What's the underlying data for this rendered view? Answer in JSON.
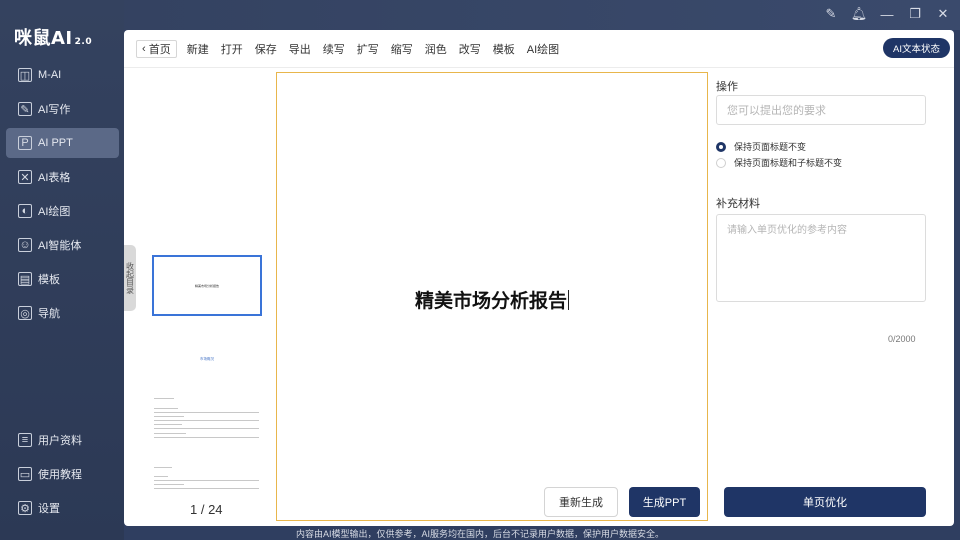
{
  "app": {
    "logo_text": "咪鼠AI",
    "logo_version": "2.0"
  },
  "sidebar": {
    "items": [
      {
        "label": "M-AI",
        "icon": "cube-icon"
      },
      {
        "label": "AI写作",
        "icon": "edit-icon"
      },
      {
        "label": "AI PPT",
        "icon": "ppt-icon",
        "active": true
      },
      {
        "label": "AI表格",
        "icon": "table-icon"
      },
      {
        "label": "AI绘图",
        "icon": "paint-icon"
      },
      {
        "label": "AI智能体",
        "icon": "robot-icon"
      },
      {
        "label": "模板",
        "icon": "template-icon"
      },
      {
        "label": "导航",
        "icon": "navigation-icon"
      }
    ],
    "bottom_items": [
      {
        "label": "用户资料",
        "icon": "user-profile-icon"
      },
      {
        "label": "使用教程",
        "icon": "tutorial-icon"
      },
      {
        "label": "设置",
        "icon": "gear-icon"
      }
    ]
  },
  "toolbar": {
    "home": "首页",
    "items": [
      "新建",
      "打开",
      "保存",
      "导出",
      "续写",
      "扩写",
      "缩写",
      "润色",
      "改写",
      "模板",
      "AI绘图"
    ],
    "ai_status": "AI文本状态"
  },
  "thumbnails": {
    "collapse_label": "收起目录",
    "slide1_title": "精美市场分析报告",
    "slide2_title": "市场概况",
    "page_indicator": "1 / 24"
  },
  "slide": {
    "title": "精美市场分析报告"
  },
  "actions": {
    "regenerate": "重新生成",
    "generate": "生成PPT"
  },
  "right_panel": {
    "operation_label": "操作",
    "request_placeholder": "您可以提出您的要求",
    "radio_options": [
      {
        "label": "保持页面标题不变",
        "checked": true
      },
      {
        "label": "保持页面标题和子标题不变",
        "checked": false
      }
    ],
    "supplement_label": "补充材料",
    "supplement_placeholder": "请输入单页优化的参考内容",
    "counter": "0/2000",
    "optimize_button": "单页优化"
  },
  "footer": {
    "text": "内容由AI模型输出，仅供参考，AI服务均在国内，后台不记录用户数据，保护用户数据安全。"
  }
}
